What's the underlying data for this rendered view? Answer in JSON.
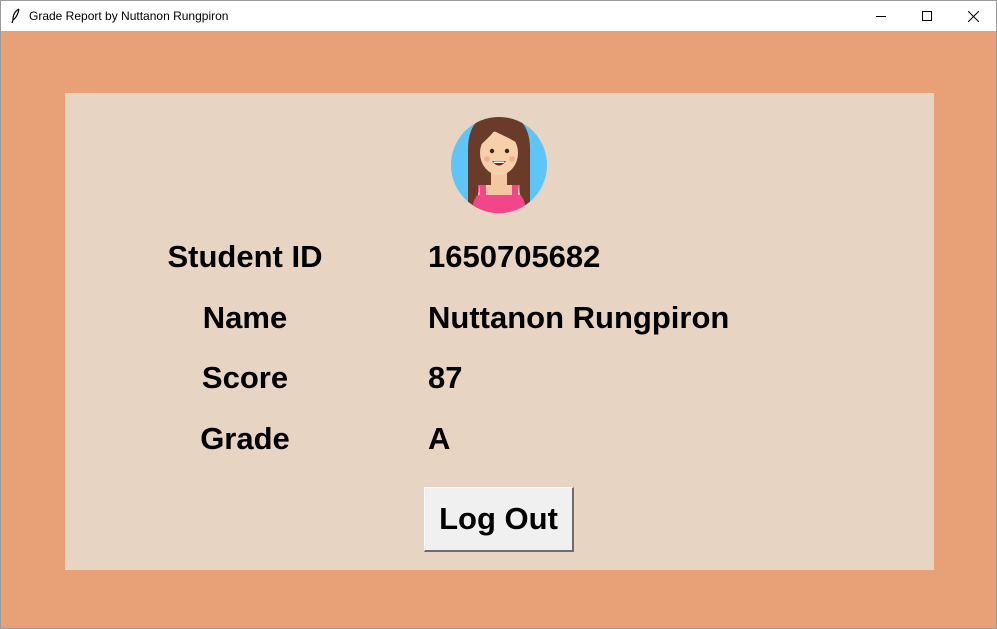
{
  "window": {
    "title": "Grade Report by Nuttanon Rungpiron",
    "icon": "feather-icon"
  },
  "controls": {
    "minimize": "minimize-icon",
    "maximize": "maximize-icon",
    "close": "close-icon"
  },
  "colors": {
    "background": "#e8a177",
    "panel": "#e8d4c3",
    "button": "#f0f0f0"
  },
  "student": {
    "fields": [
      {
        "label": "Student ID",
        "value": "1650705682"
      },
      {
        "label": "Name",
        "value": "Nuttanon Rungpiron"
      },
      {
        "label": "Score",
        "value": "87"
      },
      {
        "label": "Grade",
        "value": "A"
      }
    ]
  },
  "actions": {
    "logout_label": "Log Out"
  }
}
